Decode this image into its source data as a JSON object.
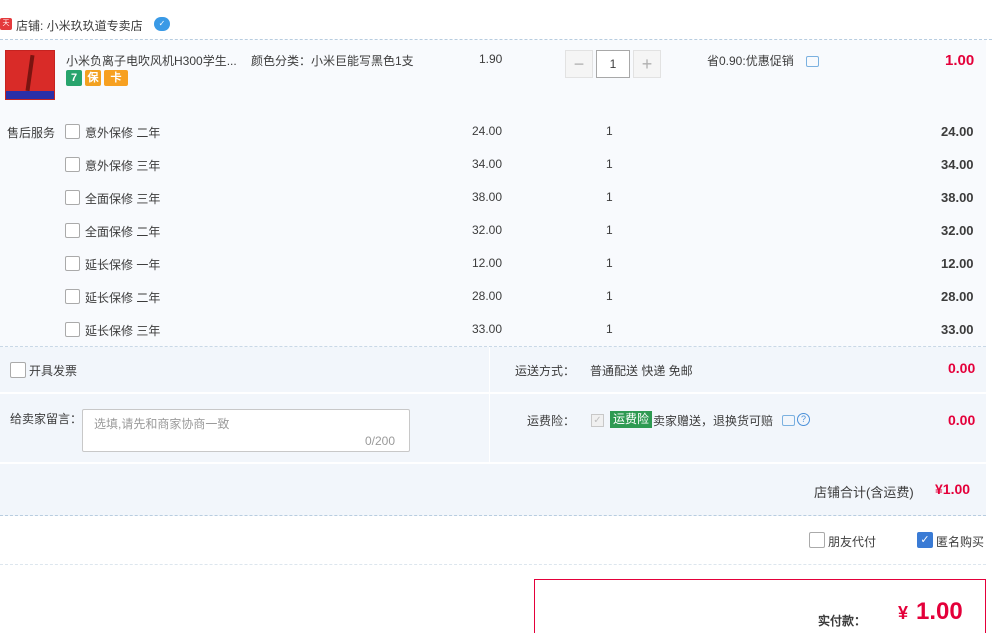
{
  "shop": {
    "badge": "天猫",
    "name": "店铺: 小米玖玖道专卖店"
  },
  "product": {
    "title": "小米负离子电吹风机H300学生...",
    "spec": "颜色分类：小米巨能写黑色1支",
    "price": "1.90",
    "quantity": "1",
    "qty_minus": "−",
    "qty_plus": "+",
    "promo": "省0.90:优惠促销",
    "total": "1.00",
    "icons": [
      "7",
      "保",
      "卡"
    ]
  },
  "services": {
    "label": "售后服务",
    "items": [
      {
        "name": "意外保修 二年",
        "price": "24.00",
        "qty": "1",
        "total": "24.00"
      },
      {
        "name": "意外保修 三年",
        "price": "34.00",
        "qty": "1",
        "total": "34.00"
      },
      {
        "name": "全面保修 三年",
        "price": "38.00",
        "qty": "1",
        "total": "38.00"
      },
      {
        "name": "全面保修 二年",
        "price": "32.00",
        "qty": "1",
        "total": "32.00"
      },
      {
        "name": "延长保修 一年",
        "price": "12.00",
        "qty": "1",
        "total": "12.00"
      },
      {
        "name": "延长保修 二年",
        "price": "28.00",
        "qty": "1",
        "total": "28.00"
      },
      {
        "name": "延长保修 三年",
        "price": "33.00",
        "qty": "1",
        "total": "33.00"
      }
    ]
  },
  "invoice": {
    "label": "开具发票"
  },
  "shipping": {
    "label": "运送方式：",
    "value": "普通配送 快递 免邮",
    "fee": "0.00"
  },
  "message": {
    "label": "给卖家留言：",
    "placeholder": "选填,请先和商家协商一致",
    "count": "0/200"
  },
  "insurance": {
    "label": "运费险：",
    "tag": "运费险",
    "text": "卖家赠送，退换货可赔",
    "fee": "0.00"
  },
  "subtotal": {
    "label": "店铺合计(含运费)",
    "value": "¥1.00"
  },
  "options": {
    "friend_pay": "朋友代付",
    "anonymous": "匿名购买"
  },
  "payment": {
    "label": "实付款：",
    "currency": "¥",
    "amount": "1.00"
  },
  "colors": {
    "accent": "#e4003a",
    "panel": "#f2f6fb",
    "link": "#3a7bd5"
  }
}
